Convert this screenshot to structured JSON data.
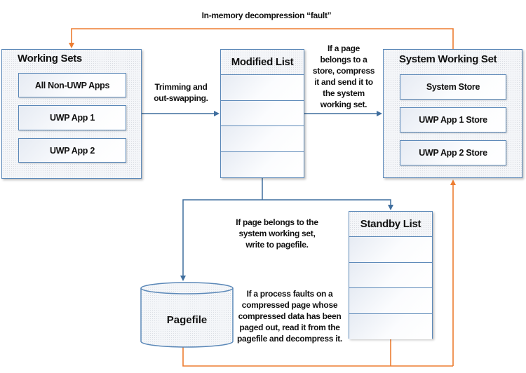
{
  "colors": {
    "blue": "#3f6e9e",
    "orange": "#ed7d31",
    "box_border": "#5b88b8"
  },
  "working_sets": {
    "title": "Working Sets",
    "items": [
      "All Non-UWP Apps",
      "UWP App 1",
      "UWP App 2"
    ]
  },
  "modified_list": {
    "title": "Modified List",
    "row_count": 4
  },
  "system_working_set": {
    "title": "System Working Set",
    "items": [
      "System Store",
      "UWP App 1 Store",
      "UWP App 2 Store"
    ]
  },
  "standby_list": {
    "title": "Standby List",
    "row_count": 4
  },
  "pagefile": {
    "label": "Pagefile"
  },
  "annotations": {
    "decompression_fault": "In-memory decompression “fault”",
    "trimming": [
      "Trimming and",
      "out-swapping."
    ],
    "compress": [
      "If a page",
      "belongs to a",
      "store, compress",
      "it and send it to",
      "the system",
      "working set."
    ],
    "write_pagefile": [
      "If page belongs to the",
      "system working set,",
      "write to pagefile."
    ],
    "read_pagefile": [
      "If a process faults on a",
      "compressed page whose",
      "compressed data has been",
      "paged out, read it from the",
      "pagefile and decompress it."
    ]
  }
}
